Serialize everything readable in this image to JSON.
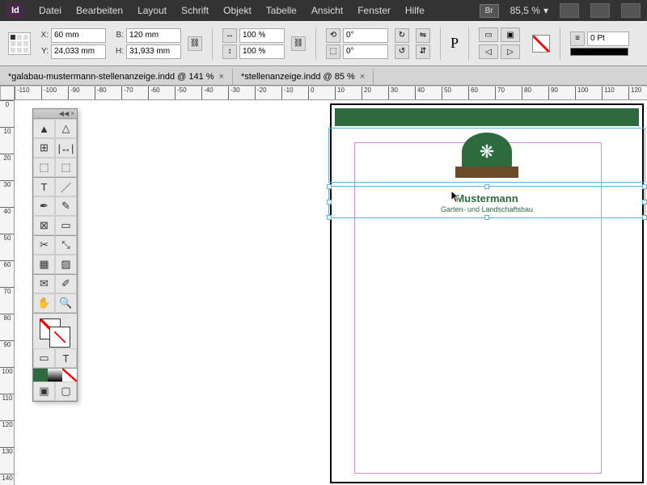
{
  "app": {
    "logo": "Id"
  },
  "menu": [
    "Datei",
    "Bearbeiten",
    "Layout",
    "Schrift",
    "Objekt",
    "Tabelle",
    "Ansicht",
    "Fenster",
    "Hilfe"
  ],
  "menubar_right": {
    "br": "Br",
    "zoom": "85,5 %"
  },
  "control": {
    "x": "60 mm",
    "y": "24,033 mm",
    "w": "120 mm",
    "h": "31,933 mm",
    "scale_x": "100 %",
    "scale_y": "100 %",
    "rotate": "0°",
    "shear": "0°",
    "stroke_pt": "0 Pt"
  },
  "tabs": [
    {
      "label": "*galabau-mustermann-stellenanzeige.indd @ 141 %"
    },
    {
      "label": "*stellenanzeige.indd @ 85 %"
    }
  ],
  "ruler_h": [
    -110,
    -100,
    -90,
    -80,
    -70,
    -60,
    -50,
    -40,
    -30,
    -20,
    -10,
    0,
    10,
    20,
    30,
    40,
    50,
    60,
    70,
    80,
    90,
    100,
    110,
    120
  ],
  "ruler_v": [
    0,
    10,
    20,
    30,
    40,
    50,
    60,
    70,
    80,
    90,
    100,
    110,
    120,
    130,
    140
  ],
  "doc": {
    "title": "Mustermann",
    "subtitle": "Garten- und Landschaftsbau"
  },
  "tools": [
    "selection",
    "direct-selection",
    "page",
    "gap",
    "content-collector",
    "content-placer",
    "type",
    "line",
    "pen",
    "pencil",
    "rectangle-frame",
    "rectangle",
    "scissors",
    "free-transform",
    "gradient-swatch",
    "gradient-feather",
    "note",
    "eyedropper",
    "hand",
    "zoom"
  ]
}
